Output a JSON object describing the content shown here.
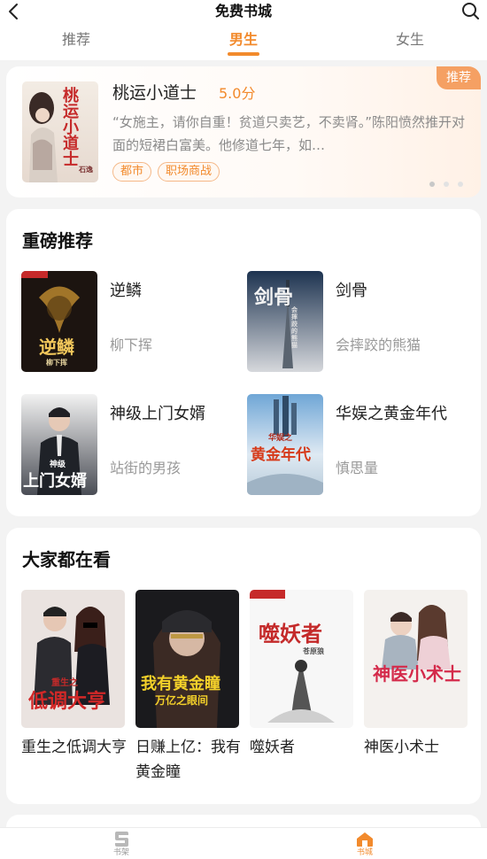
{
  "header": {
    "title": "免费书城",
    "back_icon": "back-arrow-icon",
    "search_icon": "search-icon"
  },
  "tabs": [
    {
      "label": "推荐",
      "active": false
    },
    {
      "label": "男生",
      "active": true
    },
    {
      "label": "女生",
      "active": false
    }
  ],
  "banner": {
    "title": "桃运小道士",
    "score": "5.0分",
    "description": "“女施主，请你自重！贫道只卖艺，不卖肾。”陈阳愤然推开对面的短裙白富美。他修道七年，如…",
    "tags": [
      "都市",
      "职场商战"
    ],
    "badge": "推荐",
    "cover_text": "桃运小道士",
    "cover_author": "石逸",
    "dots": 3,
    "active_dot": 0
  },
  "featured": {
    "title": "重磅推荐",
    "books": [
      {
        "name": "逆鳞",
        "author": "柳下挥",
        "cover_text": "逆鳞",
        "cover_sub": "柳下挥"
      },
      {
        "name": "剑骨",
        "author": "会摔跤的熊猫",
        "cover_text": "剑骨",
        "cover_sub": "会摔跤的熊猫"
      },
      {
        "name": "神级上门女婿",
        "author": "站街的男孩",
        "cover_text": "上门女婿",
        "cover_sub": "神级"
      },
      {
        "name": "华娱之黄金年代",
        "author": "慎思量",
        "cover_text": "黄金年代",
        "cover_sub": "华娱之"
      }
    ]
  },
  "popular": {
    "title": "大家都在看",
    "books": [
      {
        "name": "重生之低调大亨",
        "cover_text": "低调大亨",
        "cover_sub": "重生之"
      },
      {
        "name": "日赚上亿：我有黄金瞳",
        "cover_text": "我有黄金瞳",
        "cover_sub": "万亿之眼间"
      },
      {
        "name": "噬妖者",
        "cover_text": "噬妖者",
        "cover_sub": "苍原狼"
      },
      {
        "name": "神医小术士",
        "cover_text": "神医小术士",
        "cover_sub": ""
      }
    ]
  },
  "bottom_nav": [
    {
      "label": "书架",
      "icon": "bookshelf-icon",
      "active": false
    },
    {
      "label": "书城",
      "icon": "home-icon",
      "active": true
    }
  ],
  "colors": {
    "accent": "#f28a2c",
    "text_secondary": "#999999",
    "background": "#f3f3f3"
  }
}
